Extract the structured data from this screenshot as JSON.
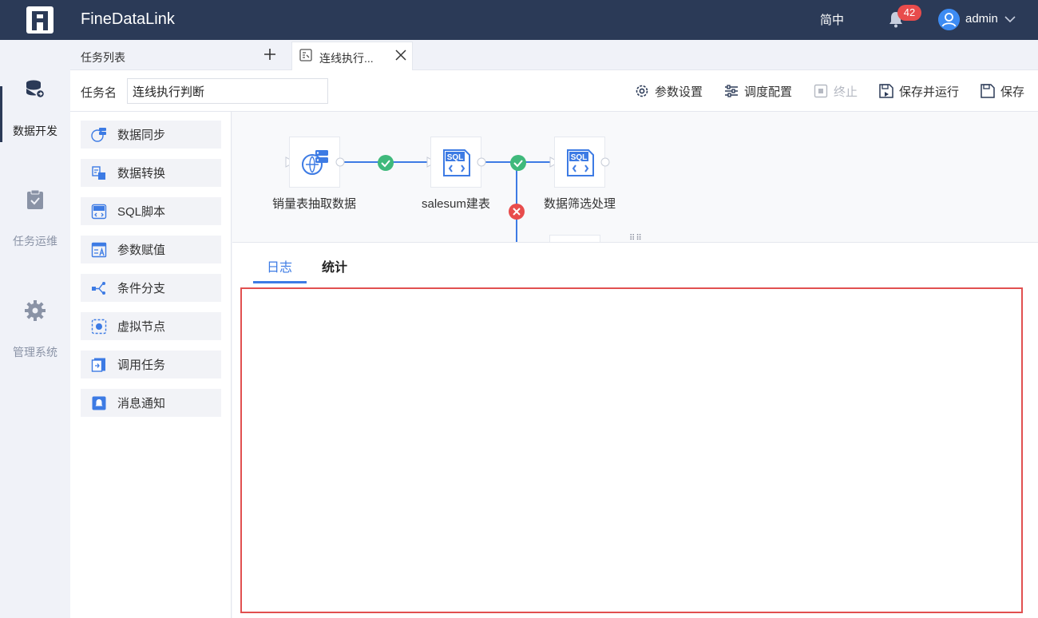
{
  "app": {
    "brand": "FineDataLink",
    "lang": "简中",
    "notification_count": "42",
    "username": "admin"
  },
  "nav": [
    {
      "label": "数据开发",
      "icon": "database-icon"
    },
    {
      "label": "任务运维",
      "icon": "clipboard-check-icon"
    },
    {
      "label": "管理系统",
      "icon": "gear-icon"
    }
  ],
  "tabs": {
    "list_label": "任务列表",
    "active_label": "连线执行..."
  },
  "task": {
    "name_label": "任务名",
    "name_value": "连线执行判断",
    "actions": {
      "params": "参数设置",
      "schedule": "调度配置",
      "stop": "终止",
      "save_run": "保存并运行",
      "save": "保存"
    }
  },
  "palette": [
    "数据同步",
    "数据转换",
    "SQL脚本",
    "参数赋值",
    "条件分支",
    "虚拟节点",
    "调用任务",
    "消息通知"
  ],
  "canvas": {
    "nodes": [
      {
        "label": "销量表抽取数据",
        "type": "data-sync"
      },
      {
        "label": "salesum建表",
        "type": "sql"
      },
      {
        "label": "数据筛选处理",
        "type": "sql"
      }
    ],
    "icon_text": "SQL"
  },
  "bottom_tabs": {
    "log": "日志",
    "stats": "统计"
  },
  "colors": {
    "topbar": "#2b3a57",
    "accent": "#3d7be4",
    "success": "#3fb97b",
    "error": "#e84c4c"
  }
}
